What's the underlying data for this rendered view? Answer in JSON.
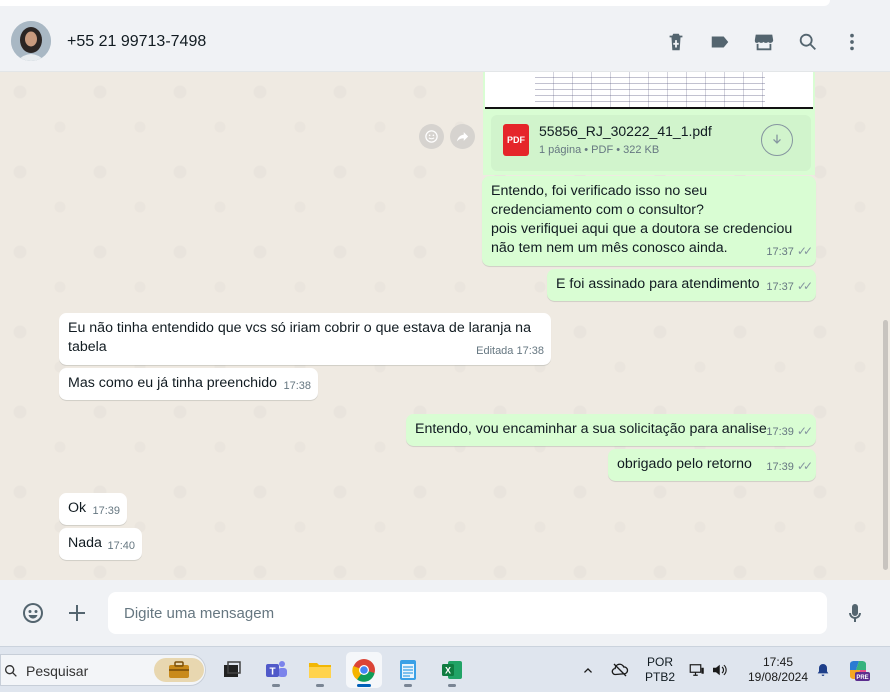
{
  "header": {
    "contact_name": "+55 21 99713-7498",
    "icons": [
      "delete-icon",
      "label-icon",
      "store-icon",
      "search-icon",
      "menu-icon"
    ]
  },
  "attachment": {
    "file_name": "55856_RJ_30222_41_1.pdf",
    "file_info": "1 página • PDF • 322 KB",
    "badge": "PDF"
  },
  "messages": [
    {
      "dir": "out",
      "lines": [
        "Entendo, foi verificado isso no seu credenciamento com o consultor?",
        "pois verifiquei aqui que a doutora se credenciou não tem nem um mês conosco ainda."
      ],
      "time": "17:37"
    },
    {
      "dir": "out",
      "text": "E foi assinado para atendimento",
      "time": "17:37"
    },
    {
      "dir": "in",
      "text": "Eu não tinha entendido que vcs só iriam cobrir  o que estava de laranja na tabela",
      "time": "Editada 17:38"
    },
    {
      "dir": "in",
      "text": "Mas como eu já tinha preenchido",
      "time": "17:38"
    },
    {
      "dir": "out",
      "text": "Entendo, vou encaminhar a sua solicitação para analise",
      "time": "17:39"
    },
    {
      "dir": "out",
      "text": "obrigado pelo retorno",
      "time": "17:39"
    },
    {
      "dir": "in",
      "text": "Ok",
      "time": "17:39"
    },
    {
      "dir": "in",
      "text": "Nada",
      "time": "17:40"
    }
  ],
  "composer": {
    "placeholder": "Digite uma mensagem"
  },
  "taskbar": {
    "search_label": "Pesquisar",
    "lang_top": "POR",
    "lang_bottom": "PTB2",
    "time": "17:45",
    "date": "19/08/2024",
    "copilot_badge": "PRE"
  },
  "colors": {
    "outgoing": "#d9fdd3",
    "incoming": "#ffffff",
    "background": "#efeae2",
    "icon": "#54656f"
  }
}
